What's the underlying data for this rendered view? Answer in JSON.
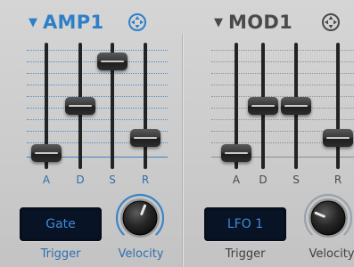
{
  "accent_color": "#2f7fc8",
  "amp": {
    "title": "AMP1",
    "collapse_icon": "triangle-down-icon",
    "nav_icon": "crosshair-navigation-icon",
    "sliders": [
      {
        "label": "A",
        "level": 0.02
      },
      {
        "label": "D",
        "level": 0.48
      },
      {
        "label": "S",
        "level": 0.92
      },
      {
        "label": "R",
        "level": 0.17
      }
    ],
    "trigger": {
      "display": "Gate",
      "label": "Trigger"
    },
    "velocity": {
      "label": "Velocity",
      "level": 0.58
    }
  },
  "mod": {
    "title": "MOD1",
    "collapse_icon": "triangle-down-icon",
    "nav_icon": "crosshair-navigation-icon",
    "sliders": [
      {
        "label": "A",
        "level": 0.02
      },
      {
        "label": "D",
        "level": 0.48
      },
      {
        "label": "S",
        "level": 0.48
      },
      {
        "label": "R",
        "level": 0.17
      }
    ],
    "trigger": {
      "display": "LFO 1",
      "label": "Trigger"
    },
    "velocity": {
      "label": "Velocity",
      "level": 0.25
    }
  }
}
